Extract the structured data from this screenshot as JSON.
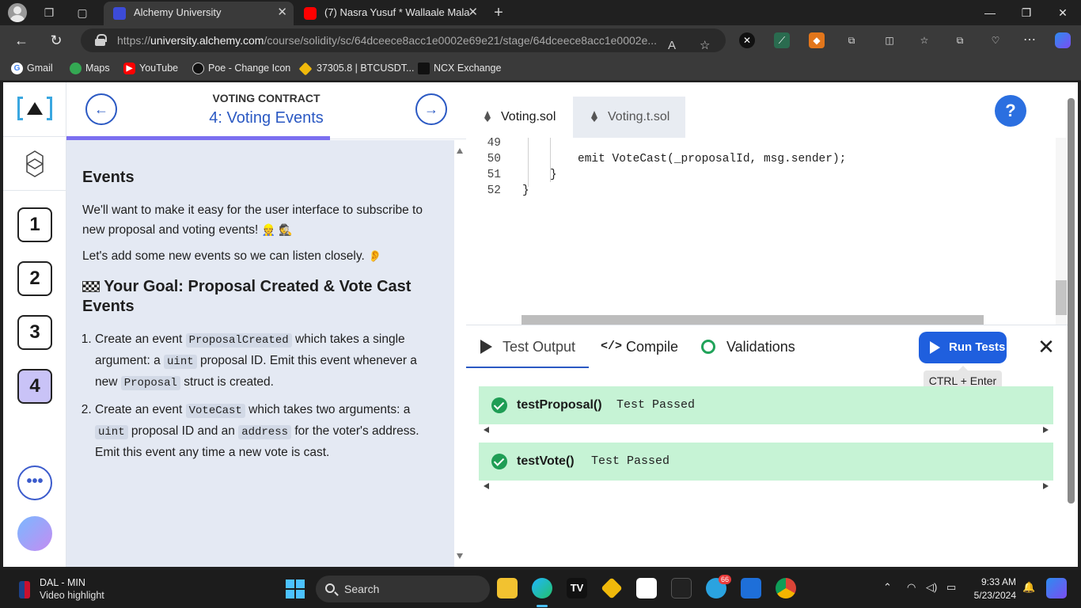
{
  "browser": {
    "tabs": [
      {
        "title": "Alchemy University",
        "favicon": "alchemy-icon",
        "active": true
      },
      {
        "title": "(7) Nasra Yusuf * Wallaale Mala",
        "favicon": "youtube-icon",
        "active": false
      }
    ],
    "new_tab": "+",
    "url_prefix": "https://",
    "url_domain": "university.alchemy.com",
    "url_path": "/course/solidity/sc/64dceece8acc1e0002e69e21/stage/64dceece8acc1e0002e...",
    "bookmarks": [
      {
        "label": "Gmail",
        "icon": "google-icon"
      },
      {
        "label": "Maps",
        "icon": "maps-pin-icon"
      },
      {
        "label": "YouTube",
        "icon": "youtube-icon"
      },
      {
        "label": "Poe - Change Icon",
        "icon": "poe-icon"
      },
      {
        "label": "37305.8 | BTCUSDT...",
        "icon": "binance-icon"
      },
      {
        "label": "NCX Exchange",
        "icon": "ncx-icon"
      }
    ]
  },
  "sidebar": {
    "stages": [
      "1",
      "2",
      "3",
      "4"
    ],
    "current_stage": "4",
    "more": "•••"
  },
  "lesson": {
    "kicker": "VOTING CONTRACT",
    "title": "4: Voting Events",
    "progress_fraction": 0.66,
    "heading": "Events",
    "para1": "We'll want to make it easy for the user interface to subscribe to new proposal and voting events!",
    "para1_emoji": "👷 🕵",
    "para2": "Let's add some new events so we can listen closely.",
    "para2_emoji": "👂",
    "goal_heading": "Your Goal: Proposal Created & Vote Cast Events",
    "steps": [
      {
        "t1": "Create an event ",
        "c1": "ProposalCreated",
        "t2": " which takes a single argument: a ",
        "c2": "uint",
        "t3": " proposal ID. Emit this event whenever a new ",
        "c3": "Proposal",
        "t4": " struct is created."
      },
      {
        "t1": "Create an event ",
        "c1": "VoteCast",
        "t2": " which takes two arguments: a ",
        "c2": "uint",
        "t3": " proposal ID and an ",
        "c3": "address",
        "t4": " for the voter's address. Emit this event any time a new vote is cast."
      }
    ]
  },
  "editor": {
    "files": [
      "Voting.sol",
      "Voting.t.sol"
    ],
    "active_file": "Voting.sol",
    "help": "?",
    "lines": [
      {
        "n": "49",
        "code": ""
      },
      {
        "n": "50",
        "code": "emit VoteCast(_proposalId, msg.sender);"
      },
      {
        "n": "51",
        "code": "}"
      },
      {
        "n": "52",
        "code": "}"
      }
    ]
  },
  "test_panel": {
    "tabs": [
      "Test Output",
      "Compile",
      "Validations"
    ],
    "active_tab": "Test Output",
    "run_label": "Run Tests",
    "shortcut_tooltip": "CTRL + Enter",
    "close": "✕",
    "results": [
      {
        "name": "testProposal()",
        "status": "Test Passed"
      },
      {
        "name": "testVote()",
        "status": "Test Passed"
      }
    ]
  },
  "taskbar": {
    "weather_title": "DAL - MIN",
    "weather_sub": "Video highlight",
    "search_placeholder": "Search",
    "telegram_badge": "66",
    "time": "9:33 AM",
    "date": "5/23/2024"
  }
}
